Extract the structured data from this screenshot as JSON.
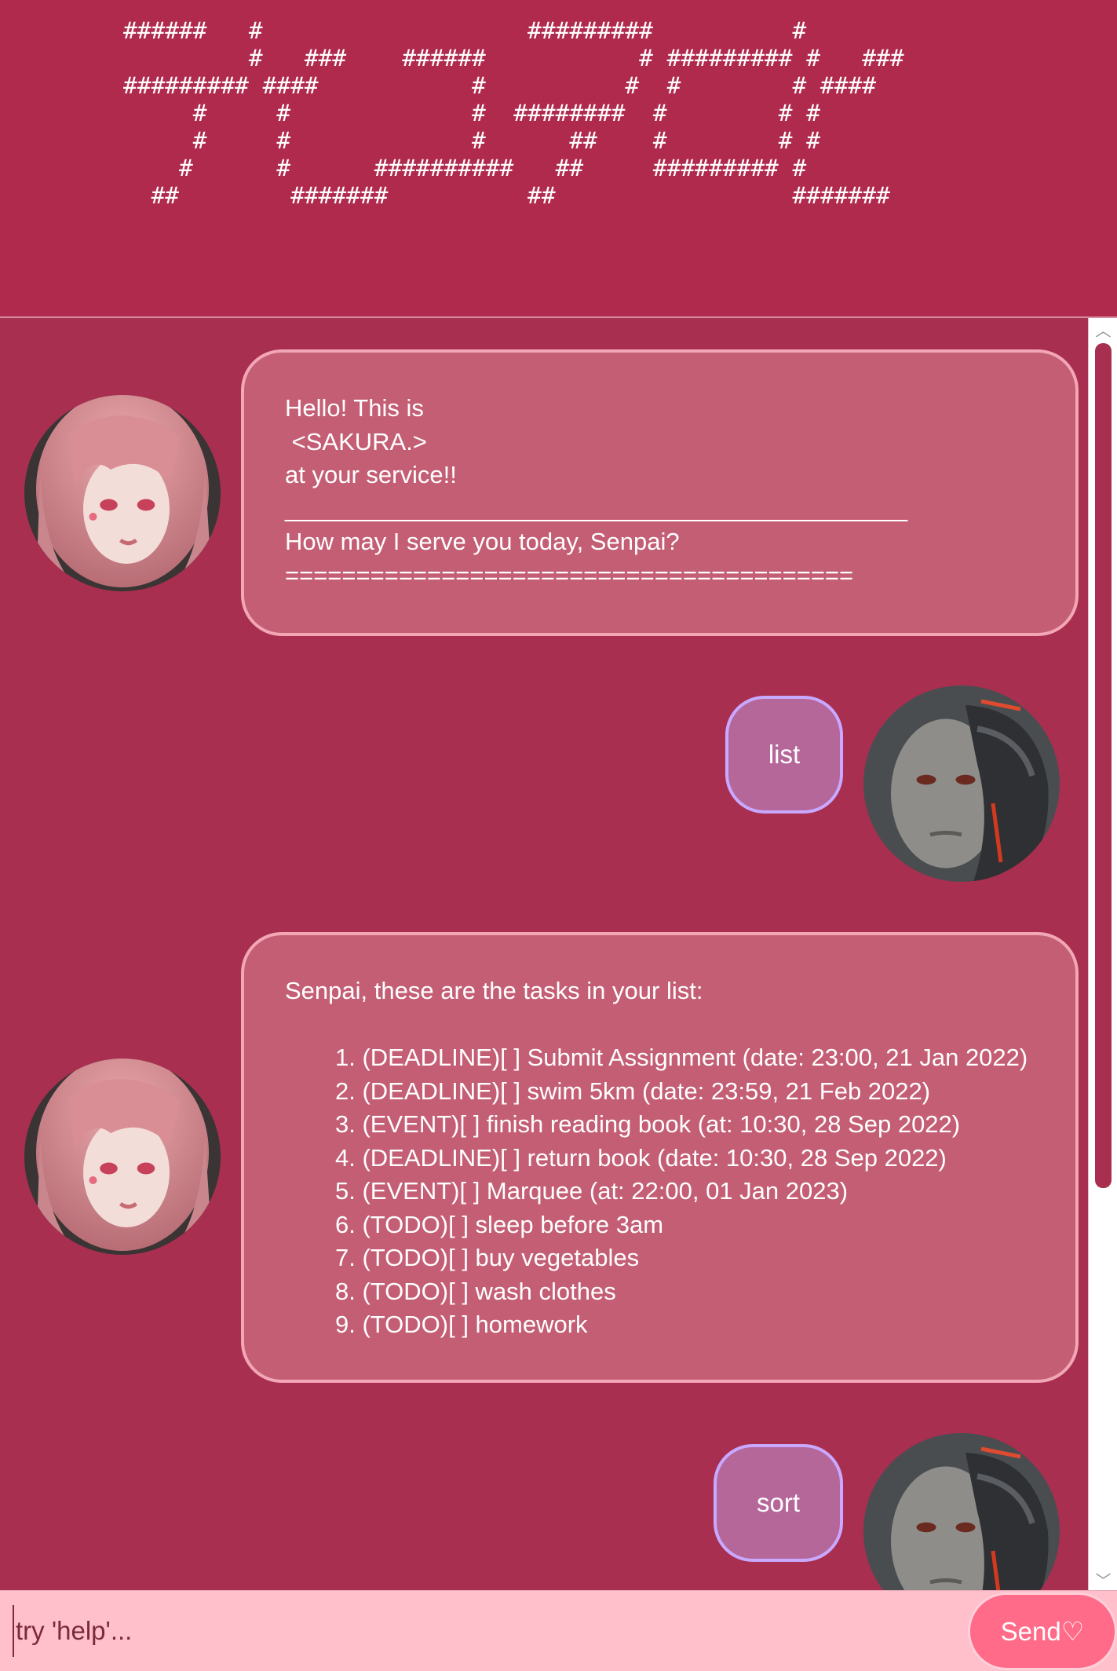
{
  "banner": {
    "ascii_art": "######   #                   #########          #\n         #   ###    ######           # ######### #   ###\n######### ####           #          #  #        # ####\n     #     #             #  ########  #        # #\n     #     #             #      ##    #        # #\n    #      #      ##########   ##     ######### #\n  ##        #######          ##                 #######"
  },
  "messages": [
    {
      "sender": "bot",
      "avatar": "sakura-avatar",
      "lines": [
        "Hello! This is",
        " <SAKURA.>",
        "at your service!!",
        "______________________________________________",
        "How may I serve you today, Senpai?",
        "========================================"
      ]
    },
    {
      "sender": "user",
      "avatar": "user-avatar",
      "text": "list"
    },
    {
      "sender": "bot",
      "avatar": "sakura-avatar",
      "intro": "Senpai, these are the tasks in your list:",
      "tasks": [
        "1. (DEADLINE)[ ] Submit Assignment (date: 23:00, 21 Jan 2022)",
        "2. (DEADLINE)[ ] swim 5km (date: 23:59, 21 Feb 2022)",
        "3. (EVENT)[ ] finish reading book (at: 10:30, 28 Sep 2022)",
        "4. (DEADLINE)[ ] return book (date: 10:30, 28 Sep 2022)",
        "5. (EVENT)[ ] Marquee (at: 22:00, 01 Jan 2023)",
        "6. (TODO)[ ] sleep before 3am",
        "7. (TODO)[ ] buy vegetables",
        "8. (TODO)[ ] wash clothes",
        "9. (TODO)[ ] homework"
      ]
    },
    {
      "sender": "user",
      "avatar": "user-avatar",
      "text": "sort"
    }
  ],
  "input": {
    "placeholder": "try 'help'...",
    "value": ""
  },
  "send_button": {
    "label": "Send♡"
  },
  "colors": {
    "banner_bg": "#b02a4d",
    "chat_bg": "#a82f4f",
    "bot_bubble": "#c45e74",
    "bot_border": "#f3a6b6",
    "user_bubble": "#b5679a",
    "user_border": "#c9a8ff",
    "input_bg": "#ffc0cb",
    "send_bg": "#ff6b88"
  }
}
